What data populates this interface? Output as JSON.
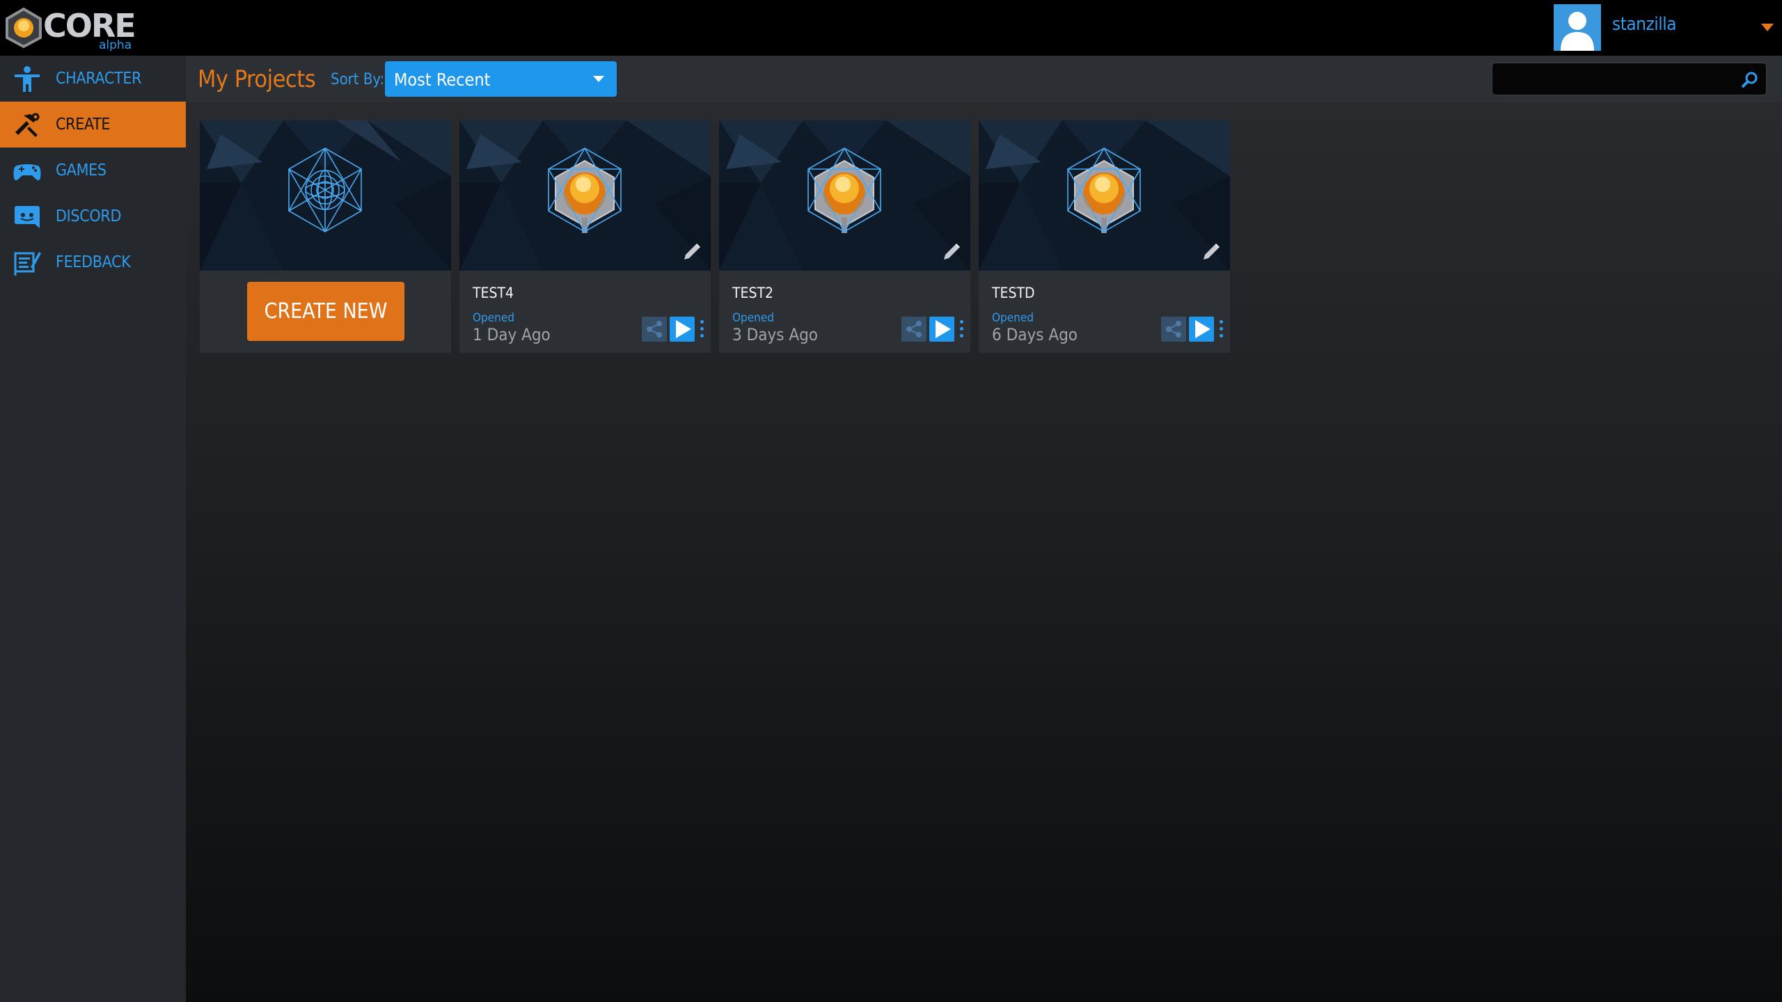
{
  "brand": {
    "word": "CORE",
    "sub": "alpha"
  },
  "user": {
    "name": "stanzilla"
  },
  "sidebar": {
    "items": [
      {
        "label": "CHARACTER",
        "icon": "person-icon",
        "active": false
      },
      {
        "label": "CREATE",
        "icon": "hammer-wrench-icon",
        "active": true
      },
      {
        "label": "GAMES",
        "icon": "gamepad-icon",
        "active": false
      },
      {
        "label": "DISCORD",
        "icon": "discord-icon",
        "active": false
      },
      {
        "label": "FEEDBACK",
        "icon": "feedback-icon",
        "active": false
      }
    ]
  },
  "header": {
    "title": "My Projects",
    "sort_label": "Sort By:",
    "sort_value": "Most Recent",
    "search_placeholder": ""
  },
  "create_card": {
    "button_label": "CREATE NEW"
  },
  "projects": [
    {
      "title": "TEST4",
      "opened_label": "Opened",
      "when": "1 Day Ago"
    },
    {
      "title": "TEST2",
      "opened_label": "Opened",
      "when": "3 Days Ago"
    },
    {
      "title": "TESTD",
      "opened_label": "Opened",
      "when": "6 Days Ago"
    }
  ],
  "colors": {
    "accent_orange": "#e0731a",
    "accent_blue": "#2f9bec",
    "sidebar_bg": "#25282c",
    "header_bg": "#2c2f33"
  }
}
